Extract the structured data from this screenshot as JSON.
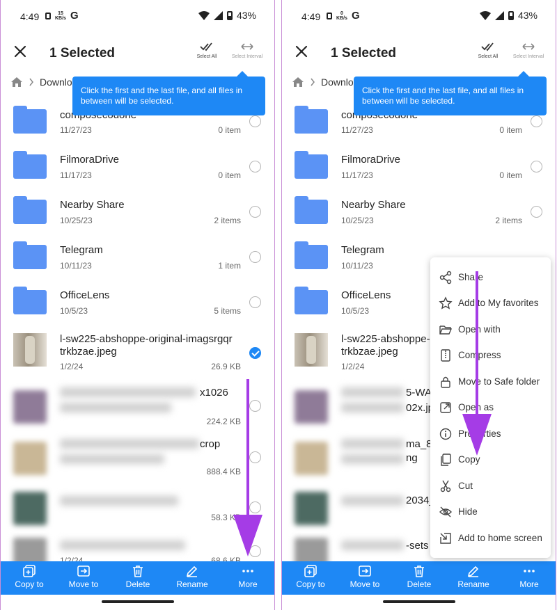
{
  "status_bar": {
    "time": "4:49",
    "battery": "43%",
    "left_speed": {
      "value": "15",
      "unit": "KB/s"
    },
    "right_speed": {
      "value": "0",
      "unit": "KB/s"
    },
    "g_label": "G"
  },
  "toolbar": {
    "title": "1 Selected",
    "select_all": "Select All",
    "select_interval": "Select Interval"
  },
  "breadcrumb": {
    "label": "Downloa"
  },
  "tooltip": {
    "text": "Click the first and the last file, and all files in between will be selected."
  },
  "files": [
    {
      "name": "composecodone",
      "date": "11/27/23",
      "size": "0 item",
      "type": "folder"
    },
    {
      "name": "FilmoraDrive",
      "date": "11/17/23",
      "size": "0 item",
      "type": "folder"
    },
    {
      "name": "Nearby Share",
      "date": "10/25/23",
      "size": "2 items",
      "type": "folder"
    },
    {
      "name": "Telegram",
      "date": "10/11/23",
      "size": "1 item",
      "type": "folder"
    },
    {
      "name": "OfficeLens",
      "date": "10/5/23",
      "size": "5 items",
      "type": "folder"
    },
    {
      "name_line1": "l-sw225-abshoppe-original-imagsrgqr",
      "name_line2": "trkbzae.jpeg",
      "name_short": "l-sw225-abshoppe-",
      "date": "1/2/24",
      "size": "26.9 KB",
      "type": "image"
    }
  ],
  "blurred_files": [
    {
      "visible_fragment_left": "x1026",
      "visible_fragment_right": "5-WA",
      "visible_fragment_right2": "02x.jp",
      "size": "224.2 KB"
    },
    {
      "visible_fragment_left": "crop",
      "visible_fragment_right": "ma_8",
      "visible_fragment_right2": "ng",
      "size": "888.4 KB"
    },
    {
      "visible_fragment_right": "2034_",
      "size": "58.3 KB"
    },
    {
      "date": "1/2/24",
      "visible_fragment_right": "-sets",
      "size": "68.6 KB"
    }
  ],
  "bottom_bar": {
    "copy_to": "Copy to",
    "move_to": "Move to",
    "delete": "Delete",
    "rename": "Rename",
    "more": "More"
  },
  "context_menu": {
    "items": [
      {
        "label": "Share",
        "icon": "share-icon"
      },
      {
        "label": "Add to My favorites",
        "icon": "star-icon"
      },
      {
        "label": "Open with",
        "icon": "folder-open-icon"
      },
      {
        "label": "Compress",
        "icon": "zip-icon"
      },
      {
        "label": "Move to Safe folder",
        "icon": "lock-icon"
      },
      {
        "label": "Open as",
        "icon": "open-external-icon"
      },
      {
        "label": "Properties",
        "icon": "info-icon"
      },
      {
        "label": "Copy",
        "icon": "copy-icon"
      },
      {
        "label": "Cut",
        "icon": "scissors-icon"
      },
      {
        "label": "Hide",
        "icon": "eye-off-icon"
      },
      {
        "label": "Add to home screen",
        "icon": "home-shortcut-icon"
      }
    ]
  },
  "colors": {
    "accent": "#1e88f5",
    "folder": "#5b93f5",
    "arrow": "#a53ce6"
  }
}
